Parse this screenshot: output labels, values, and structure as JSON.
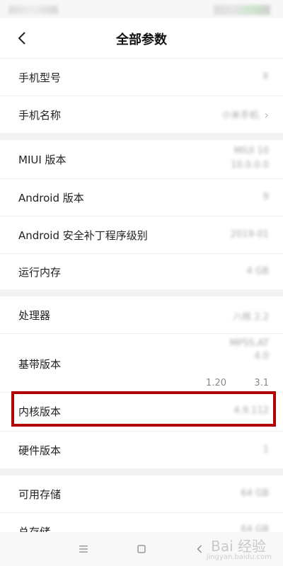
{
  "header": {
    "title": "全部参数"
  },
  "rows": [
    {
      "label": "手机型号",
      "value": "X"
    },
    {
      "label": "手机名称",
      "value": "小米手机"
    },
    {
      "label": "MIUI 版本",
      "value_line1": "MIUI 10",
      "value_line2": "10.0.0.0"
    },
    {
      "label": "Android 版本",
      "value": "9"
    },
    {
      "label": "Android 安全补丁程序级别",
      "value": "2019-01"
    },
    {
      "label": "运行内存",
      "value": "4 GB"
    },
    {
      "label": "处理器",
      "value": "八核 2.2"
    },
    {
      "label": "基带版本",
      "value_line1": "MPSS.AT",
      "value_line2": "4.0",
      "value_line3": "1.20",
      "value_line4": "3.1"
    },
    {
      "label": "内核版本",
      "value": "4.9.112"
    },
    {
      "label": "硬件版本",
      "value": "1"
    },
    {
      "label": "可用存储",
      "value": "64 GB"
    },
    {
      "label": "总存储",
      "value": "64 GB"
    }
  ],
  "watermark": {
    "text": "Bai 经验",
    "sub": "jingyan.baidu.com"
  },
  "colors": {
    "highlight": "#b00000",
    "background": "#ffffff",
    "divider": "#f2f2f2"
  },
  "nav": {
    "menu_icon": "menu-icon",
    "home_icon": "home-icon",
    "back_icon": "back-icon"
  }
}
